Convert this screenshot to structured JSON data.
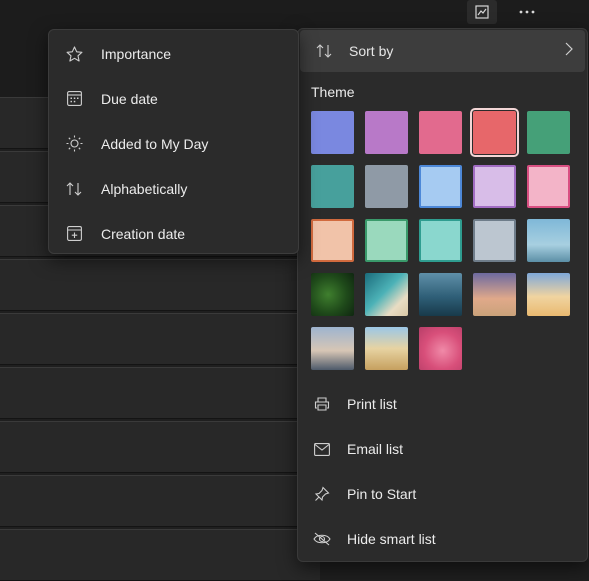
{
  "toolbar": {
    "theme_icon": "theme-picker-icon",
    "more_icon": "more-options-icon"
  },
  "sort_menu": {
    "items": [
      {
        "label": "Importance",
        "icon": "star-icon"
      },
      {
        "label": "Due date",
        "icon": "calendar-icon"
      },
      {
        "label": "Added to My Day",
        "icon": "sun-icon"
      },
      {
        "label": "Alphabetically",
        "icon": "sort-arrows-icon"
      },
      {
        "label": "Creation date",
        "icon": "calendar-add-icon"
      }
    ]
  },
  "options_menu": {
    "sort_by_label": "Sort by",
    "theme_label": "Theme",
    "themes": [
      {
        "name": "blue",
        "color": "#7a88e0",
        "type": "color"
      },
      {
        "name": "purple",
        "color": "#b879c8",
        "type": "color"
      },
      {
        "name": "pink",
        "color": "#e26a8e",
        "type": "color"
      },
      {
        "name": "red",
        "color": "#e7676a",
        "type": "color",
        "selected": true
      },
      {
        "name": "green",
        "color": "#45a078",
        "type": "color"
      },
      {
        "name": "teal",
        "color": "#47a09c",
        "type": "color"
      },
      {
        "name": "gray",
        "color": "#8f9aa6",
        "type": "color"
      },
      {
        "name": "light-blue",
        "color": "#a6cbf2",
        "border": "#4d88d8",
        "type": "color"
      },
      {
        "name": "light-purple",
        "color": "#d8bde8",
        "border": "#a16cc3",
        "type": "color"
      },
      {
        "name": "light-pink",
        "color": "#f3b4c8",
        "border": "#d94f82",
        "type": "color"
      },
      {
        "name": "light-orange",
        "color": "#f1c3a9",
        "border": "#d16a3e",
        "type": "color"
      },
      {
        "name": "mint",
        "color": "#9ad9bd",
        "border": "#3a9a6b",
        "type": "color"
      },
      {
        "name": "aqua",
        "color": "#8ad7ce",
        "border": "#2f9d90",
        "type": "color"
      },
      {
        "name": "silver",
        "color": "#bcc6d0",
        "border": "#6f7d8a",
        "type": "color"
      },
      {
        "name": "tower",
        "type": "image",
        "bg": "linear-gradient(180deg,#7fb8d8 0%,#a7cfe0 60%,#5c8fa6 100%)"
      },
      {
        "name": "fern",
        "type": "image",
        "bg": "radial-gradient(circle at 40% 50%,#3f7f2e 0%,#1f4a1a 55%,#0f2610 100%)"
      },
      {
        "name": "beach",
        "type": "image",
        "bg": "linear-gradient(135deg,#1b6c7c 0%,#4cb2b7 45%,#e8dcc3 75%,#d8c7a5 100%)"
      },
      {
        "name": "mountains",
        "type": "image",
        "bg": "linear-gradient(180deg,#5f8fa8 0%,#2f5f78 55%,#183a4a 100%)"
      },
      {
        "name": "palm-sunset",
        "type": "image",
        "bg": "linear-gradient(180deg,#6d6aa0 0%,#e0a98a 60%,#caa27a 100%)"
      },
      {
        "name": "desert",
        "type": "image",
        "bg": "linear-gradient(180deg,#7fa8d8 0%,#f0d4a0 55%,#e9b970 100%)"
      },
      {
        "name": "lighthouse",
        "type": "image",
        "bg": "linear-gradient(180deg,#9eb4cf 0%,#d7c6b5 55%,#4d5a6a 100%)"
      },
      {
        "name": "poppies",
        "type": "image",
        "bg": "linear-gradient(180deg,#9cc7e6 0%,#e7d3a2 50%,#c6a05f 100%)"
      },
      {
        "name": "pink-abstract",
        "type": "image",
        "bg": "radial-gradient(circle at 55% 55%,#f08aa8 0%,#d84f7a 55%,#b83e68 100%)"
      }
    ],
    "actions": [
      {
        "label": "Print list",
        "icon": "printer-icon"
      },
      {
        "label": "Email list",
        "icon": "mail-icon"
      },
      {
        "label": "Pin to Start",
        "icon": "pin-icon"
      },
      {
        "label": "Hide smart list",
        "icon": "eye-off-icon"
      }
    ]
  }
}
